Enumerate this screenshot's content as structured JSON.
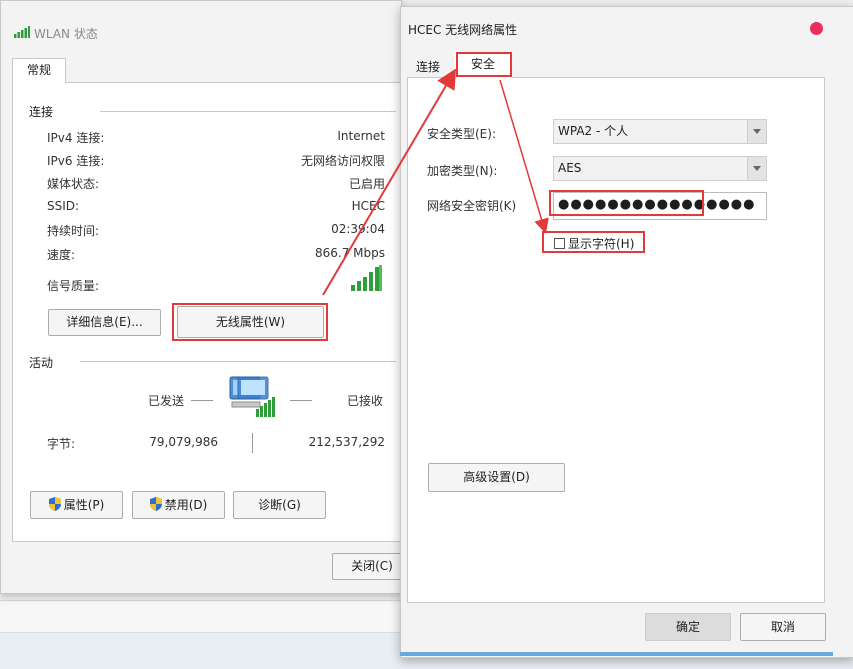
{
  "wlan": {
    "title": "WLAN 状态",
    "tab_general": "常规",
    "section_connection": "连接",
    "rows": [
      {
        "key": "IPv4 连接:",
        "value": "Internet"
      },
      {
        "key": "IPv6 连接:",
        "value": "无网络访问权限"
      },
      {
        "key": "媒体状态:",
        "value": "已启用"
      },
      {
        "key": "SSID:",
        "value": "HCEC"
      },
      {
        "key": "持续时间:",
        "value": "02:39:04"
      },
      {
        "key": "速度:",
        "value": "866.7 Mbps"
      }
    ],
    "signal_label": "信号质量:",
    "details_button": "详细信息(E)...",
    "wireless_props_button": "无线属性(W)",
    "section_activity": "活动",
    "sent_label": "已发送",
    "received_label": "已接收",
    "bytes_label": "字节:",
    "bytes_sent": "79,079,986",
    "bytes_received": "212,537,292",
    "properties_button": "属性(P)",
    "disable_button": "禁用(D)",
    "diagnose_button": "诊断(G)",
    "close_button": "关闭(C)"
  },
  "hcec": {
    "title": "HCEC 无线网络属性",
    "tab_connection": "连接",
    "tab_security": "安全",
    "security_type_label": "安全类型(E):",
    "security_type_value": "WPA2 - 个人",
    "encryption_type_label": "加密类型(N):",
    "encryption_type_value": "AES",
    "network_key_label": "网络安全密钥(K)",
    "network_key_value": "●●●●●●●●●●●●●●●●",
    "show_chars_label": "显示字符(H)",
    "advanced_button": "高级设置(D)",
    "ok_button": "确定",
    "cancel_button": "取消"
  },
  "colors": {
    "highlight": "#e23a3a",
    "close_dot": "#e8305a",
    "signal": "#2f9e3a"
  },
  "icons": {
    "signal": "wifi-signal-bars-icon",
    "computer": "network-computer-icon",
    "shield": "uac-shield-icon"
  }
}
